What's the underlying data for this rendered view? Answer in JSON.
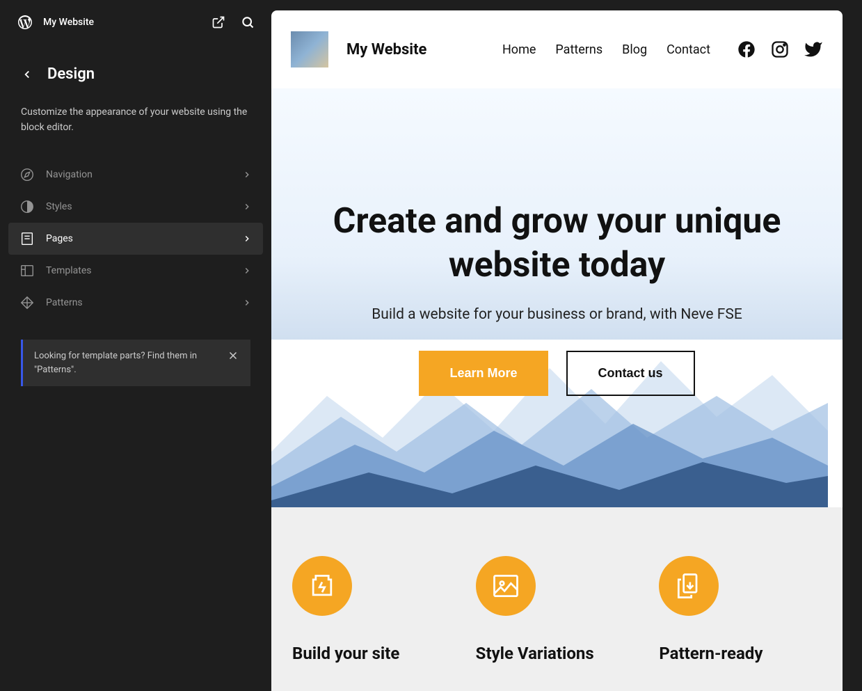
{
  "sidebar": {
    "siteName": "My Website",
    "title": "Design",
    "description": "Customize the appearance of your website using the block editor.",
    "menu": [
      {
        "label": "Navigation",
        "icon": "compass",
        "active": false
      },
      {
        "label": "Styles",
        "icon": "contrast",
        "active": false
      },
      {
        "label": "Pages",
        "icon": "page",
        "active": true
      },
      {
        "label": "Templates",
        "icon": "layout",
        "active": false
      },
      {
        "label": "Patterns",
        "icon": "diamond",
        "active": false
      }
    ],
    "notice": "Looking for template parts? Find them in \"Patterns\"."
  },
  "preview": {
    "siteTitle": "My Website",
    "nav": [
      "Home",
      "Patterns",
      "Blog",
      "Contact"
    ],
    "hero": {
      "title": "Create and grow your unique website today",
      "subtitle": "Build a website for your business or brand, with Neve FSE",
      "primaryButton": "Learn More",
      "secondaryButton": "Contact us"
    },
    "features": [
      {
        "title": "Build your site",
        "icon": "battery"
      },
      {
        "title": "Style Variations",
        "icon": "image"
      },
      {
        "title": "Pattern-ready",
        "icon": "copy"
      }
    ]
  },
  "colors": {
    "accent": "#f5a623",
    "noticeBar": "#3858e9"
  }
}
